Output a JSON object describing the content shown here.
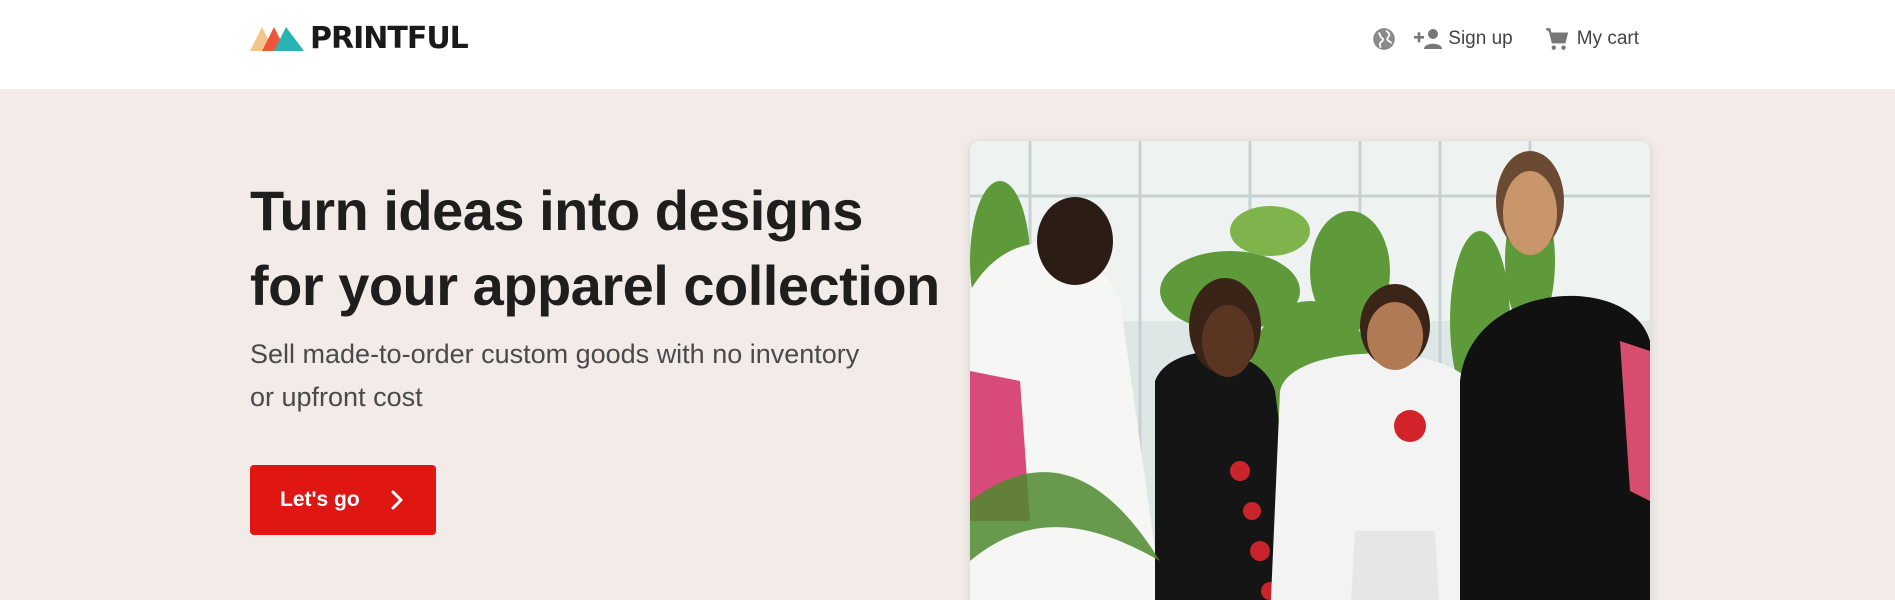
{
  "brand": {
    "name": "PRINTFUL"
  },
  "nav": {
    "language_icon": "globe-icon",
    "signup_label": "Sign up",
    "signup_icon": "person-add-icon",
    "cart_label": "My cart",
    "cart_icon": "shopping-cart-icon"
  },
  "hero": {
    "title_line1": "Turn ideas into designs",
    "title_line2": "for your apparel collection",
    "subtitle_line1": "Sell made-to-order custom goods with no inventory",
    "subtitle_line2": "or upfront cost",
    "cta_label": "Let's go",
    "cta_icon": "chevron-right-icon"
  },
  "colors": {
    "accent": "#e01613",
    "hero_background": "#f2ebe8",
    "header_background": "#ffffff"
  }
}
